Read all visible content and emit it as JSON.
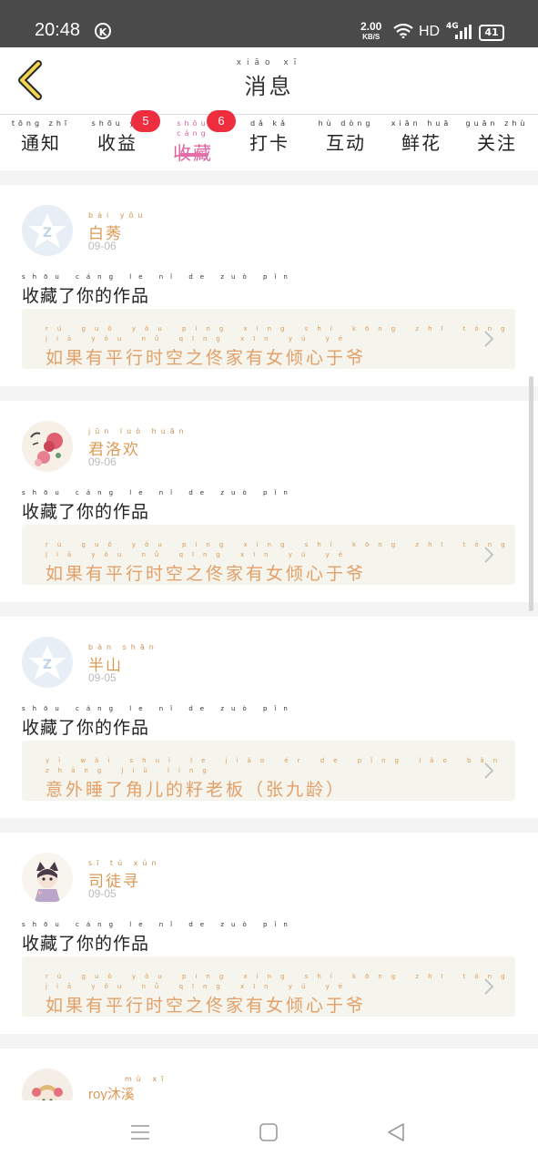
{
  "status_bar": {
    "time": "20:48",
    "k_badge": "K",
    "speed": "2.00",
    "speed_unit": "KB/S",
    "hd": "HD",
    "network": "4G",
    "battery": "41"
  },
  "header": {
    "title_pinyin": "xiāo xī",
    "title": "消息"
  },
  "tabs": [
    {
      "pinyin": "tōng zhī",
      "label": "通知",
      "badge": ""
    },
    {
      "pinyin": "shōu yì",
      "label": "收益",
      "badge": "5"
    },
    {
      "pinyin": "shōu cáng",
      "label": "收藏",
      "badge": "6",
      "active": true
    },
    {
      "pinyin": "dǎ kǎ",
      "label": "打卡",
      "badge": ""
    },
    {
      "pinyin": "hù dòng",
      "label": "互动",
      "badge": ""
    },
    {
      "pinyin": "xiān huā",
      "label": "鲜花",
      "badge": ""
    },
    {
      "pinyin": "guān zhù",
      "label": "关注",
      "badge": ""
    }
  ],
  "items": [
    {
      "user_pinyin": "bái yǒu",
      "user": "白莠",
      "date": "09-06",
      "action_pinyin": "shōu cáng le nǐ de zuò pǐn",
      "action": "收藏了你的作品",
      "work_pinyin": "rú guǒ yǒu píng xíng shí kōng zhī tóng jiā yǒu nǚ qīng xīn yú yé",
      "work": "如果有平行时空之佟家有女倾心于爷",
      "avatar": "default-avatar"
    },
    {
      "user_pinyin": "jūn luò huān",
      "user": "君洛欢",
      "date": "09-06",
      "action_pinyin": "shōu cáng le nǐ de zuò pǐn",
      "action": "收藏了你的作品",
      "work_pinyin": "rú guǒ yǒu píng xíng shí kōng zhī tóng jiā yǒu nǚ qīng xīn yú yé",
      "work": "如果有平行时空之佟家有女倾心于爷",
      "avatar": "flower-avatar"
    },
    {
      "user_pinyin": "bàn shān",
      "user": "半山",
      "date": "09-05",
      "action_pinyin": "shōu cáng le nǐ de zuò pǐn",
      "action": "收藏了你的作品",
      "work_pinyin": "yì wài shuì le jiǎo ér de pǐng lǎo bǎn zhāng jiǔ líng",
      "work": "意外睡了角儿的籽老板（张九龄）",
      "avatar": "default-avatar"
    },
    {
      "user_pinyin": "sī tú xún",
      "user": "司徒寻",
      "date": "09-05",
      "action_pinyin": "shōu cáng le nǐ de zuò pǐn",
      "action": "收藏了你的作品",
      "work_pinyin": "rú guǒ yǒu píng xíng shí kōng zhī tóng jiā yǒu nǚ qīng xīn yú yé",
      "work": "如果有平行时空之佟家有女倾心于爷",
      "avatar": "anime-avatar"
    },
    {
      "user_pinyin": "mù xī",
      "user": "roy沐溪",
      "date": "",
      "action_pinyin": "",
      "action": "",
      "work_pinyin": "",
      "work": "",
      "avatar": "anime-avatar-2"
    }
  ]
}
